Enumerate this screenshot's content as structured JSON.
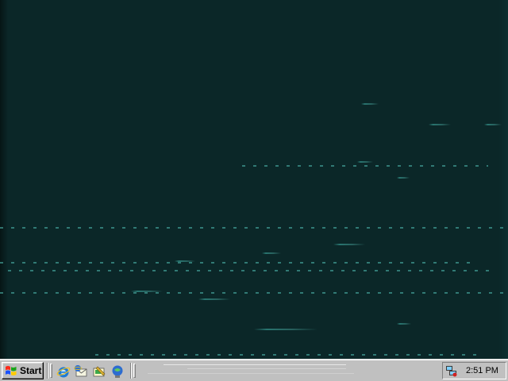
{
  "taskbar": {
    "start_label": "Start",
    "clock": "2:51 PM"
  },
  "quick_launch": [
    {
      "icon": "internet-explorer-icon"
    },
    {
      "icon": "outlook-express-icon"
    },
    {
      "icon": "show-desktop-icon"
    },
    {
      "icon": "channels-icon"
    }
  ],
  "tray": {
    "icon": "network-tray-icon"
  },
  "colors": {
    "desktop": "#0b2728",
    "taskbar": "#c0c0c0",
    "streak": "#40b4aa"
  }
}
